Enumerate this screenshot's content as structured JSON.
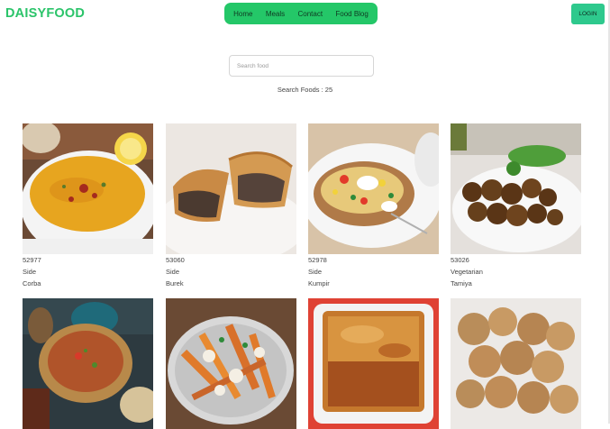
{
  "header": {
    "brand": "DAISYFOOD",
    "nav": [
      "Home",
      "Meals",
      "Contact",
      "Food Blog"
    ],
    "login": "LOGIN"
  },
  "search": {
    "placeholder": "Search food",
    "value": "",
    "count_text": "Search Foods : 25"
  },
  "foods": [
    {
      "id": "52977",
      "category": "Side",
      "name": "Corba"
    },
    {
      "id": "53060",
      "category": "Side",
      "name": "Burek"
    },
    {
      "id": "52978",
      "category": "Side",
      "name": "Kumpir"
    },
    {
      "id": "53026",
      "category": "Vegetarian",
      "name": "Tamiya"
    },
    {
      "id": "",
      "category": "",
      "name": ""
    },
    {
      "id": "",
      "category": "",
      "name": ""
    },
    {
      "id": "",
      "category": "",
      "name": ""
    },
    {
      "id": "",
      "category": "",
      "name": ""
    }
  ]
}
